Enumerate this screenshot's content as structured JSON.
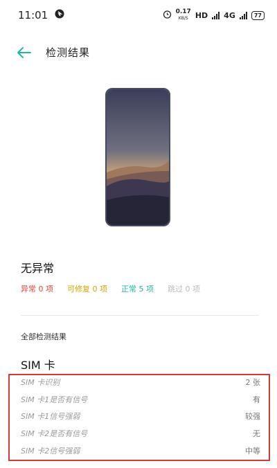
{
  "status_bar": {
    "time": "11:01",
    "speed_value": "0.17",
    "speed_unit": "KB/S",
    "hd_label": "HD",
    "network_label": "4G",
    "battery": "77"
  },
  "header": {
    "title": "检测结果"
  },
  "result": {
    "title": "无异常",
    "stats": {
      "error": "异常 0 项",
      "warning": "可修复 0 项",
      "normal": "正常 5 项",
      "skipped": "跳过 0 项"
    }
  },
  "all_results_label": "全部检测结果",
  "sim_section": {
    "title": "SIM 卡",
    "rows": [
      {
        "label": "SIM 卡识别",
        "value": "2 张"
      },
      {
        "label": "SIM 卡1是否有信号",
        "value": "有"
      },
      {
        "label": "SIM 卡1信号强弱",
        "value": "较强"
      },
      {
        "label": "SIM 卡2是否有信号",
        "value": "无"
      },
      {
        "label": "SIM 卡2信号强弱",
        "value": "中等"
      }
    ]
  },
  "colors": {
    "accent": "#1fb8a0",
    "error": "#e04a3a",
    "warning": "#d4a400",
    "highlight_border": "#d43a3a"
  }
}
